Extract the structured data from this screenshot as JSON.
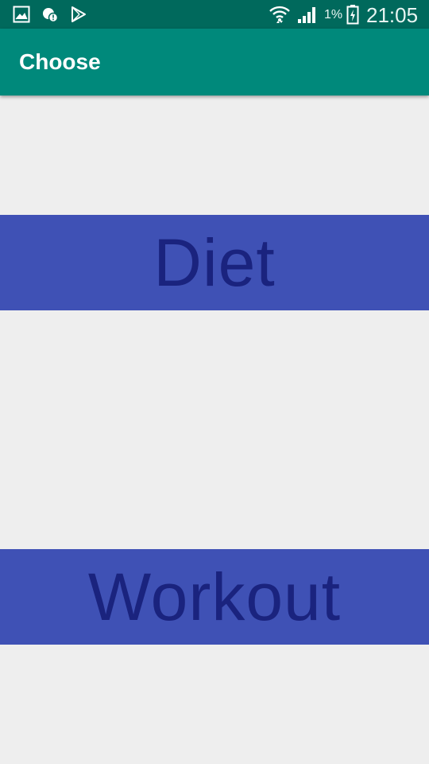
{
  "status_bar": {
    "left_icons": [
      "image-icon",
      "alert-cloud-icon",
      "play-store-icon"
    ],
    "right_icons": [
      "wifi-icon",
      "signal-icon",
      "battery-charging-icon"
    ],
    "battery_percent": "1%",
    "time": "21:05",
    "background_color": "#00695c"
  },
  "app_bar": {
    "title": "Choose",
    "background_color": "#00897b"
  },
  "main": {
    "buttons": [
      {
        "label": "Diet"
      },
      {
        "label": "Workout"
      }
    ],
    "button_color": "#3f51b5",
    "button_text_color": "#1a237e",
    "background_color": "#eeeeee"
  }
}
